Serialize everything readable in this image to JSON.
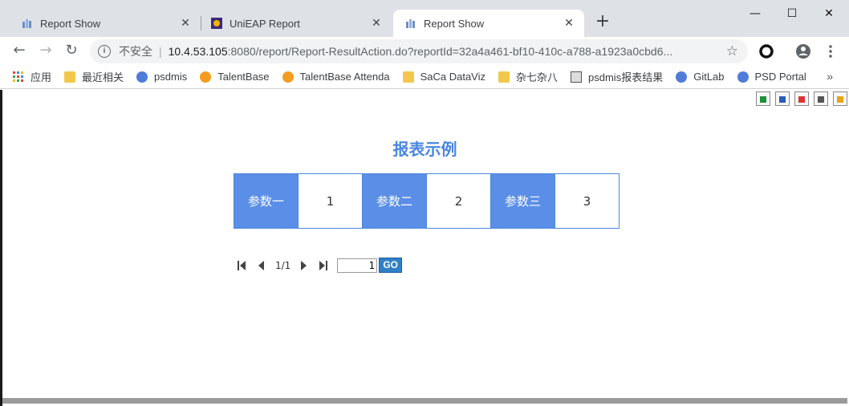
{
  "tabs": [
    {
      "title": "Report Show",
      "active": false
    },
    {
      "title": "UniEAP Report",
      "active": false
    },
    {
      "title": "Report Show",
      "active": true
    }
  ],
  "window_controls": {
    "minimize": "—",
    "maximize": "☐",
    "close": "✕"
  },
  "omnibox": {
    "security_label": "不安全",
    "url_host": "10.4.53.105",
    "url_rest": ":8080/report/Report-ResultAction.do?reportId=32a4a461-bf10-410c-a788-a1923a0cbd6..."
  },
  "bookmarks": [
    {
      "label": "应用",
      "icon": "apps-grid-icon"
    },
    {
      "label": "最近相关",
      "icon": "folder-icon"
    },
    {
      "label": "psdmis",
      "icon": "globe-icon"
    },
    {
      "label": "TalentBase",
      "icon": "talentbase-icon"
    },
    {
      "label": "TalentBase Attenda",
      "icon": "talentbase-icon"
    },
    {
      "label": "SaCa DataViz",
      "icon": "folder-icon"
    },
    {
      "label": "杂七杂八",
      "icon": "folder-icon"
    },
    {
      "label": "psdmis报表结果",
      "icon": "image-icon"
    },
    {
      "label": "GitLab",
      "icon": "globe-icon"
    },
    {
      "label": "PSD Portal",
      "icon": "globe-icon"
    }
  ],
  "bookmarks_more": "»",
  "report": {
    "title": "报表示例",
    "params": [
      {
        "label": "参数一",
        "value": "1"
      },
      {
        "label": "参数二",
        "value": "2"
      },
      {
        "label": "参数三",
        "value": "3"
      }
    ]
  },
  "pager": {
    "indicator": "1/1",
    "input_value": "1",
    "go_label": "GO"
  },
  "colors": {
    "accent": "#4a86e0",
    "label_bg": "#5b8ee6",
    "go_button": "#2f80c8"
  }
}
